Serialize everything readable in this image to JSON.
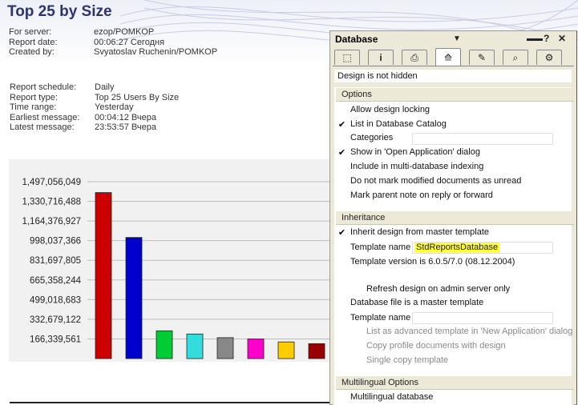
{
  "report": {
    "title": "Top 25 by Size",
    "meta": [
      {
        "label": "For server:",
        "value": "ezop/POMKOP"
      },
      {
        "label": "Report date:",
        "value": "00:06:27 Сегодня"
      },
      {
        "label": "Created by:",
        "value": "Svyatoslav Ruchenin/POMKOP"
      }
    ],
    "details": [
      {
        "label": "Report schedule:",
        "value": "Daily"
      },
      {
        "label": "Report type:",
        "value": "Top 25 Users By Size"
      },
      {
        "label": "Time range:",
        "value": "Yesterday"
      },
      {
        "label": "Earliest message:",
        "value": "00:04:12 Вчера"
      },
      {
        "label": "Latest message:",
        "value": "23:53:57 Вчера"
      }
    ]
  },
  "chart_data": {
    "type": "bar",
    "yticks": [
      "1,497,056,049",
      "1,330,716,488",
      "1,164,376,927",
      "998,037,366",
      "831,697,805",
      "665,358,244",
      "499,018,683",
      "332,679,122",
      "166,339,561"
    ],
    "ytick_values": [
      1497056049,
      1330716488,
      1164376927,
      998037366,
      831697805,
      665358244,
      499018683,
      332679122,
      166339561
    ],
    "ylim": [
      0,
      1497056049
    ],
    "values": [
      1405000000,
      1025000000,
      235000000,
      208000000,
      177000000,
      166000000,
      141000000,
      126000000
    ],
    "colors": [
      "#cc0000",
      "#0000cc",
      "#00cc33",
      "#33dddd",
      "#888888",
      "#ff00cc",
      "#ffcc00",
      "#990000"
    ],
    "grid": true
  },
  "panel": {
    "title": "Database",
    "tab_icons": [
      "info-tab-icon",
      "i",
      "print-tab-icon",
      "design-tab-icon",
      "brush-tab-icon",
      "search-tab-icon",
      "network-tab-icon"
    ],
    "status": "Design is not hidden",
    "options": {
      "header": "Options",
      "allow_locking": {
        "label": "Allow design locking",
        "checked": false
      },
      "list_catalog": {
        "label": "List in Database Catalog",
        "checked": true
      },
      "categories_label": "Categories",
      "categories_value": "",
      "show_open_app": {
        "label": "Show in 'Open Application' dialog",
        "checked": true
      },
      "multi_db_index": {
        "label": "Include in multi-database indexing",
        "checked": false
      },
      "no_unread": {
        "label": "Do not mark modified documents as unread",
        "checked": false
      },
      "mark_parent": {
        "label": "Mark parent note on reply or forward",
        "checked": false
      }
    },
    "inheritance": {
      "header": "Inheritance",
      "inherit": {
        "label": "Inherit design from master template",
        "checked": true
      },
      "template_name_label": "Template name",
      "template_name_value": "StdReportsDatabase",
      "template_version": "Template version is 6.0.5/7.0 (08.12.2004)",
      "refresh": {
        "label": "Refresh design on admin server only",
        "checked": false
      },
      "is_master": {
        "label": "Database file is a master template",
        "checked": false
      },
      "template_name2_label": "Template name",
      "template_name2_value": "",
      "list_advanced": {
        "label": "List as advanced template in 'New Application' dialog",
        "checked": false
      },
      "copy_profile": {
        "label": "Copy profile documents with design",
        "checked": false
      },
      "single_copy": {
        "label": "Single copy template",
        "checked": false
      }
    },
    "multilingual": {
      "header": "Multilingual Options",
      "multilingual_db": {
        "label": "Multilingual database",
        "checked": false
      }
    }
  }
}
